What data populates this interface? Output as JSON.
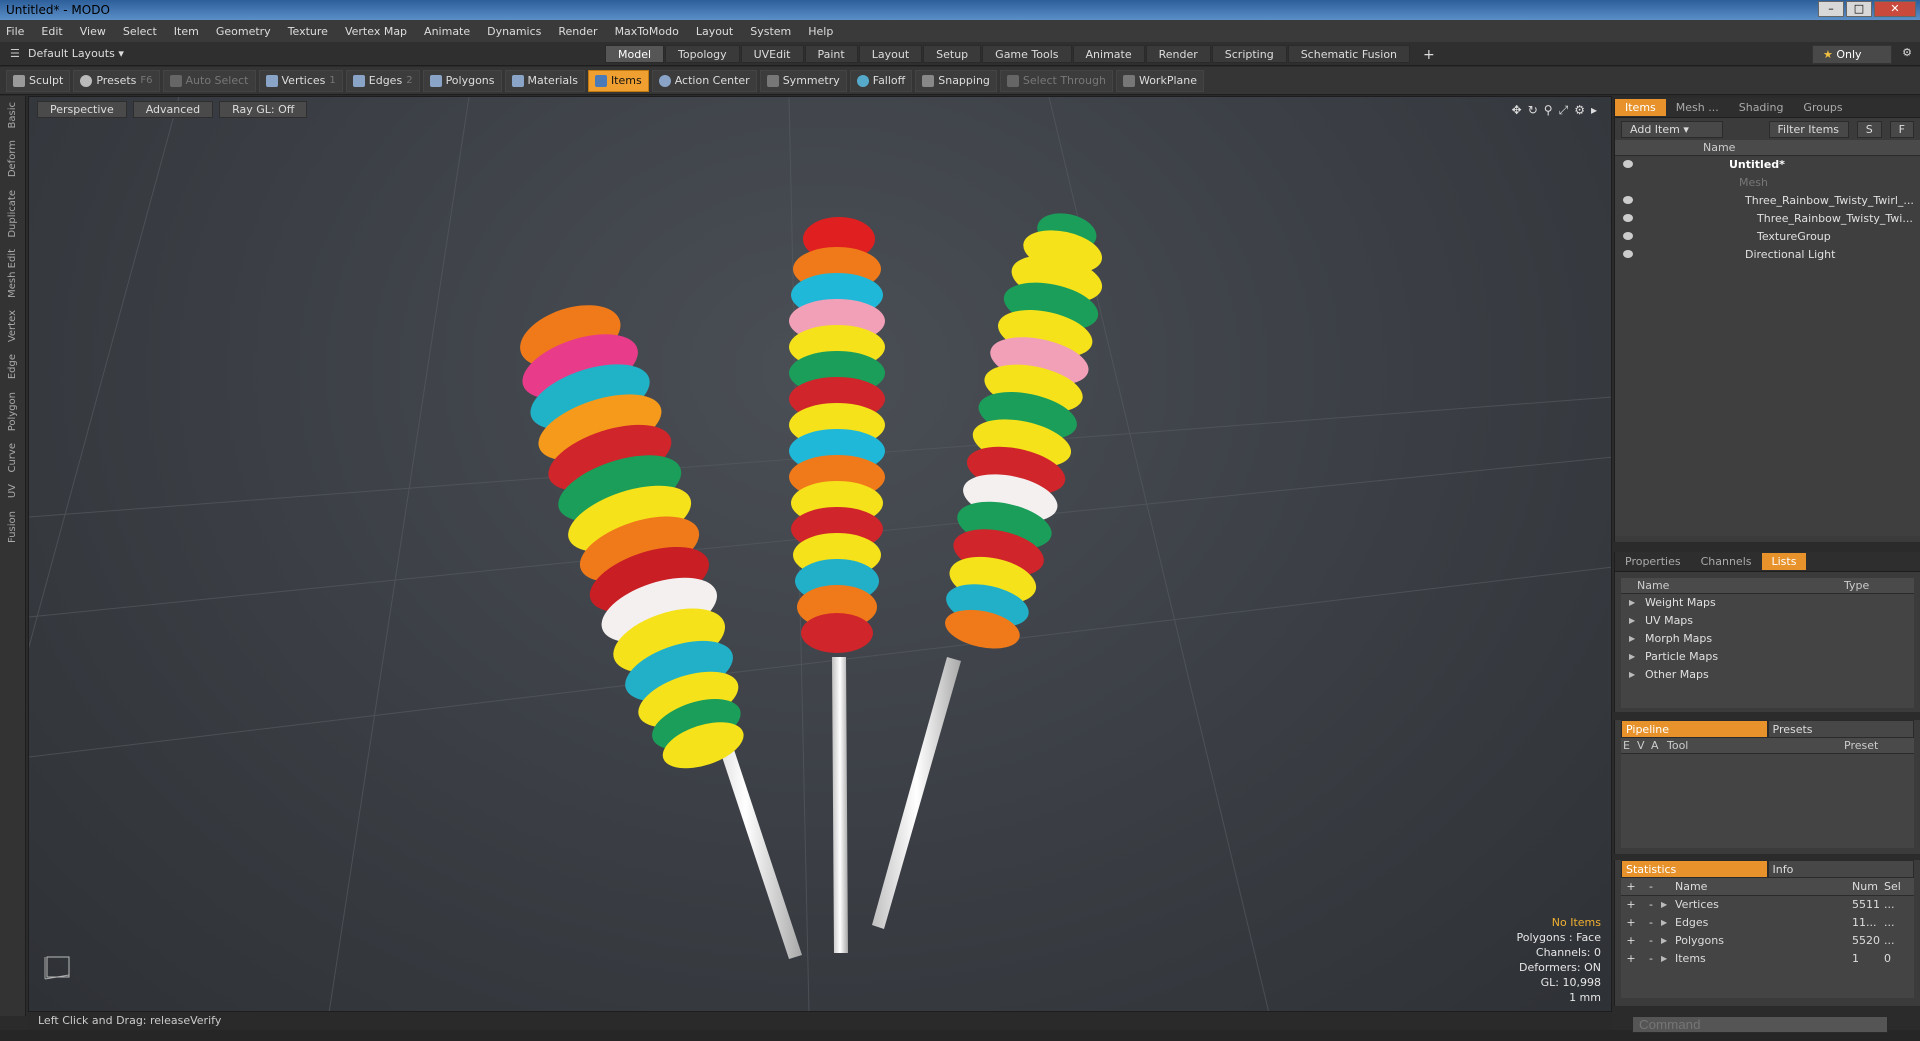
{
  "window": {
    "title": "Untitled* - MODO"
  },
  "menu": [
    "File",
    "Edit",
    "View",
    "Select",
    "Item",
    "Geometry",
    "Texture",
    "Vertex Map",
    "Animate",
    "Dynamics",
    "Render",
    "MaxToModo",
    "Layout",
    "System",
    "Help"
  ],
  "layouts_label": "Default Layouts",
  "mode_tabs": [
    "Model",
    "Topology",
    "UVEdit",
    "Paint",
    "Layout",
    "Setup",
    "Game Tools",
    "Animate",
    "Render",
    "Scripting",
    "Schematic Fusion"
  ],
  "only_label": "Only",
  "toolbar": {
    "sculpt": "Sculpt",
    "presets": "Presets",
    "presets_key": "F6",
    "auto_select": "Auto Select",
    "vertices": "Vertices",
    "vertices_key": "1",
    "edges": "Edges",
    "edges_key": "2",
    "polygons": "Polygons",
    "materials": "Materials",
    "items": "Items",
    "action_center": "Action Center",
    "symmetry": "Symmetry",
    "falloff": "Falloff",
    "snapping": "Snapping",
    "select_through": "Select Through",
    "workplane": "WorkPlane"
  },
  "left_tabs": [
    "Basic",
    "Deform",
    "Duplicate",
    "Mesh Edit",
    "Vertex",
    "Edge",
    "Polygon",
    "Curve",
    "UV",
    "Fusion"
  ],
  "viewport": {
    "view": "Perspective",
    "shading": "Advanced",
    "raygl": "Ray GL: Off",
    "hud": {
      "no_items": "No Items",
      "polygons": "Polygons : Face",
      "channels": "Channels: 0",
      "deformers": "Deformers: ON",
      "gl": "GL: 10,998",
      "unit": "1 mm"
    }
  },
  "status": {
    "hint": "Left Click and Drag:  releaseVerify"
  },
  "items_panel": {
    "tabs": [
      "Items",
      "Mesh ...",
      "Shading",
      "Groups"
    ],
    "add_item": "Add Item",
    "filter": "Filter Items",
    "s_btn": "S",
    "f_btn": "F",
    "name_col": "Name",
    "tree": [
      "Untitled*",
      "Mesh",
      "Three_Rainbow_Twisty_Twirl_...",
      "Three_Rainbow_Twisty_Twi...",
      "TextureGroup",
      "Directional Light"
    ]
  },
  "props_panel": {
    "tabs": [
      "Properties",
      "Channels",
      "Lists"
    ],
    "name_col": "Name",
    "type_col": "Type",
    "maps": [
      "Weight Maps",
      "UV Maps",
      "Morph Maps",
      "Particle Maps",
      "Other Maps"
    ]
  },
  "pipeline_panel": {
    "tabs": [
      "Pipeline",
      "Presets"
    ],
    "cols": [
      "E",
      "V",
      "A",
      "Tool",
      "Preset"
    ]
  },
  "stats_panel": {
    "tabs": [
      "Statistics",
      "Info"
    ],
    "cols": {
      "name": "Name",
      "num": "Num",
      "sel": "Sel"
    },
    "rows": [
      {
        "name": "Vertices",
        "num": "5511",
        "sel": "..."
      },
      {
        "name": "Edges",
        "num": "11...",
        "sel": "..."
      },
      {
        "name": "Polygons",
        "num": "5520",
        "sel": "..."
      },
      {
        "name": "Items",
        "num": "1",
        "sel": "0"
      }
    ]
  },
  "command": {
    "placeholder": "Command"
  },
  "colors": {
    "accent": "#e7922a",
    "highlight": "#f0a030"
  }
}
